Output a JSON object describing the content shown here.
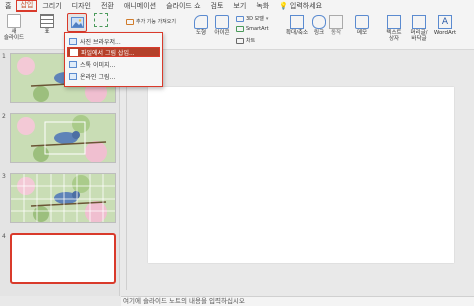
{
  "tabs": [
    "홈",
    "삽입",
    "그리기",
    "디자인",
    "전환",
    "애니메이션",
    "슬라이드 쇼",
    "검토",
    "보기",
    "녹화"
  ],
  "active_tab": "삽입",
  "help_label": "입력하세요",
  "ribbon": {
    "new_slide": "새\n슬라이드",
    "table": "표",
    "add_in": "추가 기능 가져오기",
    "shapes": "도형",
    "icons": "아이콘",
    "model3d": "3D 모델",
    "smartart": "SmartArt",
    "chart": "차트",
    "zoom": "확대/축소",
    "link": "링크",
    "action": "동작",
    "comment": "메모",
    "textbox": "텍스트\n상자",
    "header_footer": "머리글/\n바닥글",
    "wordart": "WordArt"
  },
  "dropdown": {
    "items": [
      {
        "label": "사진 브라우저..."
      },
      {
        "label": "파일에서 그림 삽입..."
      },
      {
        "label": "스톡 이미지..."
      },
      {
        "label": "온라인 그림..."
      }
    ],
    "highlighted_index": 1
  },
  "slides": [
    {
      "number": "1"
    },
    {
      "number": "2"
    },
    {
      "number": "3"
    },
    {
      "number": "4"
    }
  ],
  "notes_placeholder": "여기에 슬라이드 노트의 내용을 입력하십시오",
  "colors": {
    "accent": "#d93a2b",
    "highlight": "#b4412a"
  }
}
